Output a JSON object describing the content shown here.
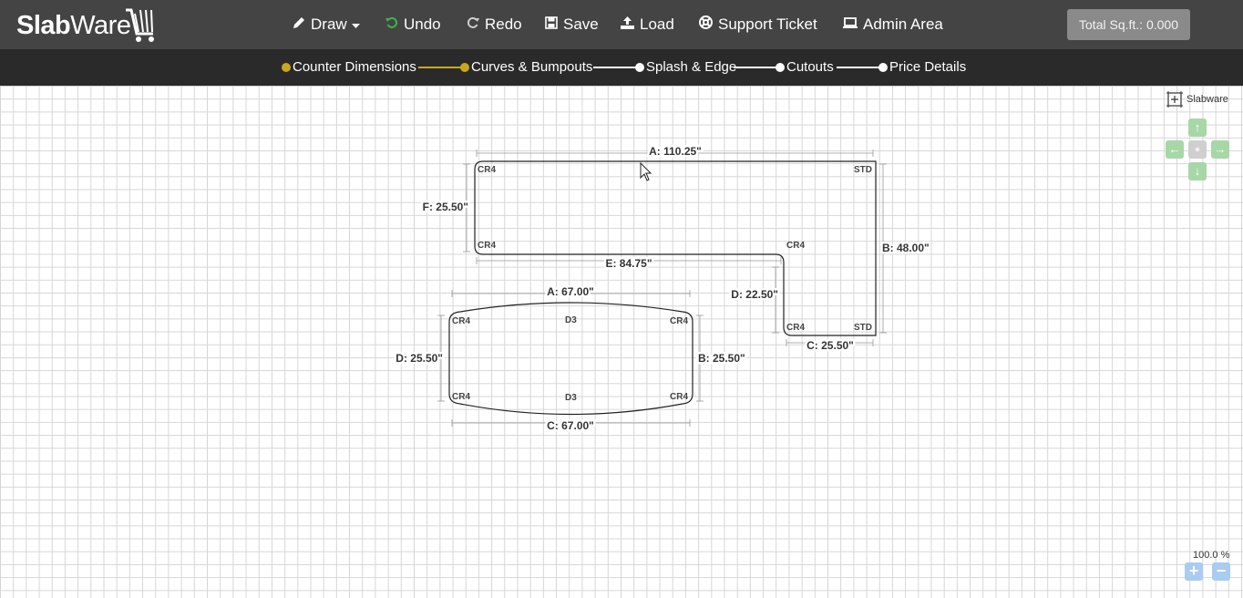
{
  "app": {
    "logo_bold": "Slab",
    "logo_light": "Ware"
  },
  "menu": {
    "draw": "Draw",
    "undo": "Undo",
    "redo": "Redo",
    "save": "Save",
    "load": "Load",
    "support": "Support Ticket",
    "admin": "Admin Area"
  },
  "icons": {
    "draw": "pencil-icon",
    "undo": "undo-icon",
    "redo": "redo-icon",
    "save": "floppy-disk-icon",
    "load": "upload-icon",
    "support": "lifebuoy-icon",
    "admin": "laptop-icon",
    "dropdown": "caret-down-icon"
  },
  "sqft": {
    "label": "Total Sq.ft.: 0.000"
  },
  "steps": [
    {
      "label": "Counter Dimensions",
      "state": "active",
      "color": "#c9a81e"
    },
    {
      "label": "Curves & Bumpouts",
      "state": "active",
      "color": "#c9a81e"
    },
    {
      "label": "Splash & Edge",
      "state": "pending",
      "color": "#ffffff"
    },
    {
      "label": "Cutouts",
      "state": "pending",
      "color": "#ffffff"
    },
    {
      "label": "Price Details",
      "state": "pending",
      "color": "#ffffff"
    }
  ],
  "canvas": {
    "compass_label": "Slabware",
    "zoom": "100.0 %",
    "zoom_in": "+",
    "zoom_out": "−",
    "nav": {
      "up": "↑",
      "left": "←",
      "center": "●",
      "right": "→",
      "down": "↓"
    }
  },
  "shape1": {
    "dims": {
      "a": "A: 110.25\"",
      "b": "B: 48.00\"",
      "c": "C: 25.50\"",
      "d": "D: 22.50\"",
      "e": "E: 84.75\"",
      "f": "F: 25.50\""
    },
    "corners": {
      "top_left": "CR4",
      "top_right": "STD",
      "inner_left": "CR4",
      "inner_right": "CR4",
      "bottom_left": "CR4",
      "bottom_right": "STD"
    }
  },
  "shape2": {
    "dims": {
      "a": "A: 67.00\"",
      "b": "B: 25.50\"",
      "c": "C: 67.00\"",
      "d": "D: 25.50\""
    },
    "corners": {
      "top_left": "CR4",
      "top_right": "CR4",
      "bottom_left": "CR4",
      "bottom_right": "CR4"
    },
    "curves": {
      "top": "D3",
      "bottom": "D3"
    }
  },
  "colors": {
    "topbar": "#444444",
    "stepbar": "#2a2a2a",
    "step_active": "#c9a81e",
    "undo_icon": "#3bb54a",
    "nav_button": "#a7d7a7",
    "zoom_button": "#a9ccf0"
  }
}
